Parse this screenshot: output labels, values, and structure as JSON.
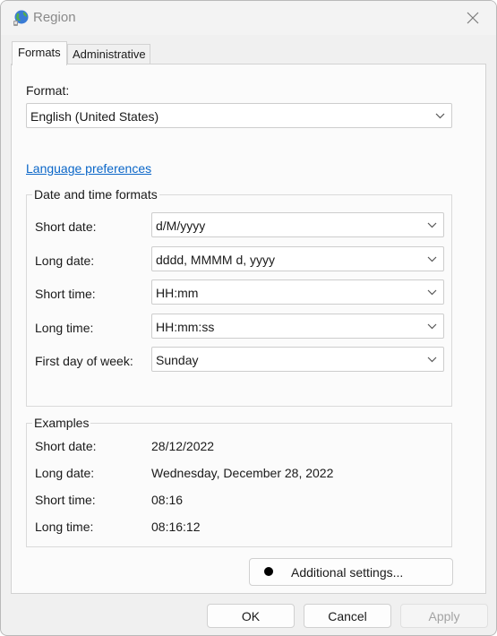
{
  "window": {
    "title": "Region"
  },
  "tabs": [
    {
      "label": "Formats",
      "active": true
    },
    {
      "label": "Administrative",
      "active": false
    }
  ],
  "format": {
    "label": "Format:",
    "value": "English (United States)"
  },
  "language_link": "Language preferences",
  "date_time_formats": {
    "title": "Date and time formats",
    "rows": [
      {
        "label": "Short date:",
        "value": "d/M/yyyy"
      },
      {
        "label": "Long date:",
        "value": "dddd, MMMM d, yyyy"
      },
      {
        "label": "Short time:",
        "value": "HH:mm"
      },
      {
        "label": "Long time:",
        "value": "HH:mm:ss"
      },
      {
        "label": "First day of week:",
        "value": "Sunday"
      }
    ]
  },
  "examples": {
    "title": "Examples",
    "rows": [
      {
        "label": "Short date:",
        "value": "28/12/2022"
      },
      {
        "label": "Long date:",
        "value": "Wednesday, December 28, 2022"
      },
      {
        "label": "Short time:",
        "value": "08:16"
      },
      {
        "label": "Long time:",
        "value": "08:16:12"
      }
    ]
  },
  "additional_settings": {
    "label": "Additional settings..."
  },
  "buttons": {
    "ok": "OK",
    "cancel": "Cancel",
    "apply": "Apply"
  },
  "icons": {
    "app": "globe-icon",
    "close": "close-icon",
    "dropdown": "chevron-down-icon"
  },
  "colors": {
    "link": "#0a66c8",
    "disabled_text": "#a3a3a3"
  }
}
